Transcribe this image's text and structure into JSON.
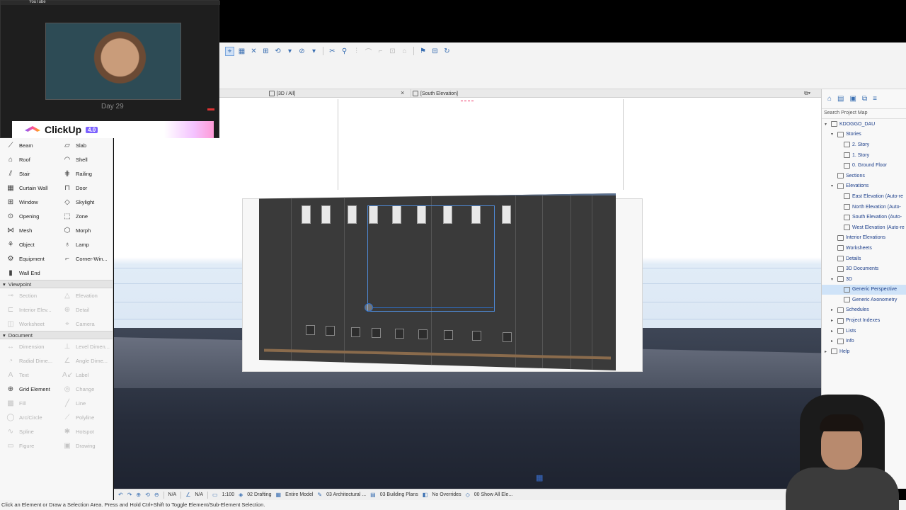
{
  "webcam": {
    "top_label": "YouTube",
    "day_label": "Day 29",
    "banner_brand": "ClickUp",
    "banner_version": "4.0"
  },
  "tabs": {
    "tab_3d": "[3D / All]",
    "tab_south": "[South Elevation]"
  },
  "toolbox": {
    "design_tools": [
      {
        "label": "Beam",
        "icon": "beam-icon"
      },
      {
        "label": "Slab",
        "icon": "slab-icon"
      },
      {
        "label": "Roof",
        "icon": "roof-icon"
      },
      {
        "label": "Shell",
        "icon": "shell-icon"
      },
      {
        "label": "Stair",
        "icon": "stair-icon"
      },
      {
        "label": "Railing",
        "icon": "railing-icon"
      },
      {
        "label": "Curtain Wall",
        "icon": "curtain-wall-icon"
      },
      {
        "label": "Door",
        "icon": "door-icon"
      },
      {
        "label": "Window",
        "icon": "window-icon"
      },
      {
        "label": "Skylight",
        "icon": "skylight-icon"
      },
      {
        "label": "Opening",
        "icon": "opening-icon"
      },
      {
        "label": "Zone",
        "icon": "zone-icon"
      },
      {
        "label": "Mesh",
        "icon": "mesh-icon"
      },
      {
        "label": "Morph",
        "icon": "morph-icon"
      },
      {
        "label": "Object",
        "icon": "object-icon"
      },
      {
        "label": "Lamp",
        "icon": "lamp-icon"
      },
      {
        "label": "Equipment",
        "icon": "equipment-icon"
      },
      {
        "label": "Corner-Win...",
        "icon": "corner-window-icon"
      },
      {
        "label": "Wall End",
        "icon": "wall-end-icon"
      }
    ],
    "viewpoint_title": "Viewpoint",
    "viewpoint_tools": [
      {
        "label": "Section",
        "icon": "section-icon"
      },
      {
        "label": "Elevation",
        "icon": "elevation-icon"
      },
      {
        "label": "Interior Elev...",
        "icon": "interior-elevation-icon"
      },
      {
        "label": "Detail",
        "icon": "detail-icon"
      },
      {
        "label": "Worksheet",
        "icon": "worksheet-icon"
      },
      {
        "label": "Camera",
        "icon": "camera-icon"
      }
    ],
    "document_title": "Document",
    "document_tools": [
      {
        "label": "Dimension",
        "icon": "dimension-icon",
        "active": false
      },
      {
        "label": "Level Dimen...",
        "icon": "level-dimension-icon",
        "active": false
      },
      {
        "label": "Radial Dime...",
        "icon": "radial-dimension-icon",
        "active": false
      },
      {
        "label": "Angle Dime...",
        "icon": "angle-dimension-icon",
        "active": false
      },
      {
        "label": "Text",
        "icon": "text-icon",
        "active": false
      },
      {
        "label": "Label",
        "icon": "label-icon",
        "active": false
      },
      {
        "label": "Grid Element",
        "icon": "grid-element-icon",
        "active": true
      },
      {
        "label": "Change",
        "icon": "change-icon",
        "active": false
      },
      {
        "label": "Fill",
        "icon": "fill-icon",
        "active": false
      },
      {
        "label": "Line",
        "icon": "line-icon",
        "active": false
      },
      {
        "label": "Arc/Circle",
        "icon": "arc-circle-icon",
        "active": false
      },
      {
        "label": "Polyline",
        "icon": "polyline-icon",
        "active": false
      },
      {
        "label": "Spline",
        "icon": "spline-icon",
        "active": false
      },
      {
        "label": "Hotspot",
        "icon": "hotspot-icon",
        "active": false
      },
      {
        "label": "Figure",
        "icon": "figure-icon",
        "active": false
      },
      {
        "label": "Drawing",
        "icon": "drawing-icon",
        "active": false
      }
    ]
  },
  "navigator": {
    "search_placeholder": "Search Project Map",
    "tree": [
      {
        "label": "KDOGGO_DAU",
        "depth": 0,
        "arrow": "▾",
        "selected": false
      },
      {
        "label": "Stories",
        "depth": 1,
        "arrow": "▾",
        "selected": false
      },
      {
        "label": "2. Story",
        "depth": 2,
        "arrow": "",
        "selected": false
      },
      {
        "label": "1. Story",
        "depth": 2,
        "arrow": "",
        "selected": false
      },
      {
        "label": "0. Ground Floor",
        "depth": 2,
        "arrow": "",
        "selected": false
      },
      {
        "label": "Sections",
        "depth": 1,
        "arrow": "",
        "selected": false
      },
      {
        "label": "Elevations",
        "depth": 1,
        "arrow": "▾",
        "selected": false
      },
      {
        "label": "East Elevation (Auto-re",
        "depth": 2,
        "arrow": "",
        "selected": false
      },
      {
        "label": "North Elevation (Auto-",
        "depth": 2,
        "arrow": "",
        "selected": false
      },
      {
        "label": "South Elevation (Auto-",
        "depth": 2,
        "arrow": "",
        "selected": false
      },
      {
        "label": "West Elevation (Auto-re",
        "depth": 2,
        "arrow": "",
        "selected": false
      },
      {
        "label": "Interior Elevations",
        "depth": 1,
        "arrow": "",
        "selected": false
      },
      {
        "label": "Worksheets",
        "depth": 1,
        "arrow": "",
        "selected": false
      },
      {
        "label": "Details",
        "depth": 1,
        "arrow": "",
        "selected": false
      },
      {
        "label": "3D Documents",
        "depth": 1,
        "arrow": "",
        "selected": false
      },
      {
        "label": "3D",
        "depth": 1,
        "arrow": "▾",
        "selected": false
      },
      {
        "label": "Generic Perspective",
        "depth": 2,
        "arrow": "",
        "selected": true
      },
      {
        "label": "Generic Axonometry",
        "depth": 2,
        "arrow": "",
        "selected": false
      },
      {
        "label": "Schedules",
        "depth": 1,
        "arrow": "▸",
        "selected": false
      },
      {
        "label": "Project Indexes",
        "depth": 1,
        "arrow": "▸",
        "selected": false
      },
      {
        "label": "Lists",
        "depth": 1,
        "arrow": "▸",
        "selected": false
      },
      {
        "label": "Info",
        "depth": 1,
        "arrow": "▸",
        "selected": false
      },
      {
        "label": "Help",
        "depth": 0,
        "arrow": "▸",
        "selected": false
      }
    ]
  },
  "statusbar": {
    "na_1": "N/A",
    "na_2": "N/A",
    "scale": "1:100",
    "layer_combo": "02 Drafting",
    "model_view": "Entire Model",
    "pen_set": "03 Architectural ...",
    "building_plans": "03 Building Plans",
    "overrides": "No Overrides",
    "renovation": "00 Show All Ele..."
  },
  "hint_text": "Click an Element or Draw a Selection Area. Press and Hold Ctrl+Shift to Toggle Element/Sub-Element Selection.",
  "colors": {
    "accent": "#3a6fb2",
    "selection": "#2f6fc8",
    "building": "#3a3a3a"
  }
}
